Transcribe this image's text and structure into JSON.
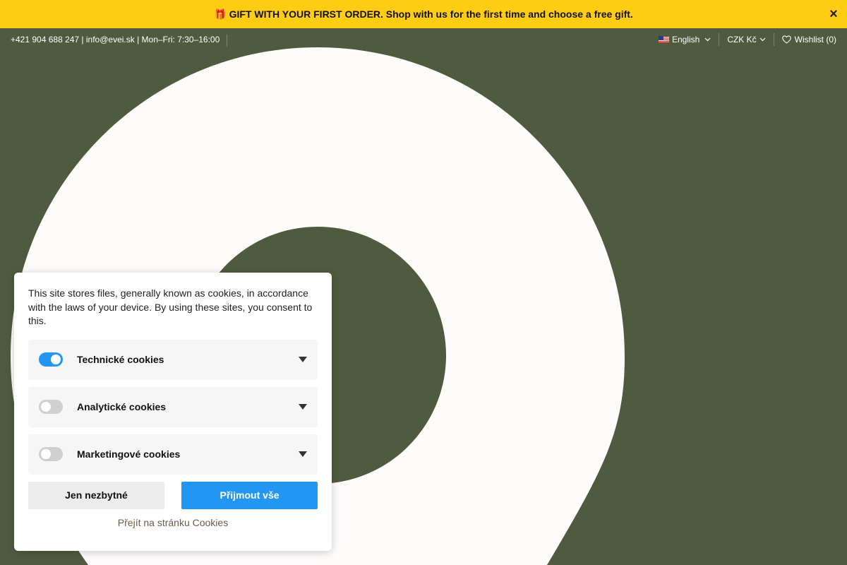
{
  "announcement": {
    "text": "GIFT WITH YOUR FIRST ORDER. Shop with us for the first time and choose a free gift.",
    "icon": "gift-icon",
    "close_label": "×",
    "background": "#ffcc14"
  },
  "topbar": {
    "contact": "+421 904 688 247 | info@evei.sk | Mon–Fri: 7:30–16:00",
    "language": "English",
    "currency": "CZK Kč",
    "wishlist": "Wishlist (0)"
  },
  "hero": {
    "background": "#4f5b3e",
    "shape_color": "#fdfcfb"
  },
  "cookies": {
    "text": "This site stores files, generally known as cookies, in accordance with the laws of your device. By using these sites, you consent to this.",
    "categories": [
      {
        "label": "Technické cookies",
        "enabled": true
      },
      {
        "label": "Analytické cookies",
        "enabled": false
      },
      {
        "label": "Marketingové cookies",
        "enabled": false
      }
    ],
    "necessary_button": "Jen nezbytné",
    "accept_button": "Přijmout vše",
    "cookie_page_link": "Přejít na stránku Cookies",
    "accent": "#2196f3"
  }
}
